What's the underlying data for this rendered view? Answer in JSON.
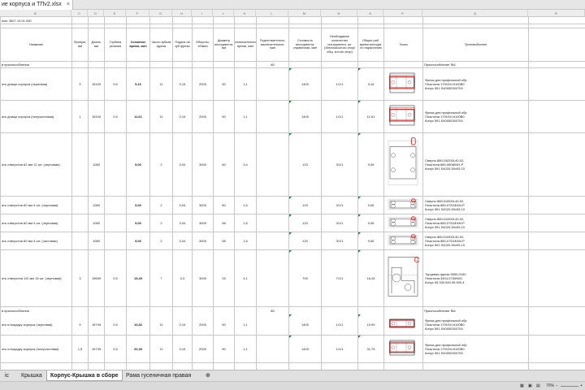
{
  "document": {
    "title": "ие корпуса и ТПv2.xlsx",
    "close_label": "×",
    "title_note": "ния: 3507.10.01.000"
  },
  "columns": [
    "B",
    "C",
    "D",
    "E",
    "F",
    "G",
    "H",
    "I",
    "J",
    "K",
    "L",
    "M",
    "N",
    "O",
    "P",
    "Q",
    "R",
    "S"
  ],
  "headers": {
    "name": "Название",
    "allowance": "Припуск, мм",
    "length": "Длина, мм",
    "depth": "Глубина резания",
    "main_time": "Основное время, мин",
    "teeth": "Число зубьев фрезы",
    "feed": "Подача на зуб фрезы",
    "rpm": "Обороты, об/мин",
    "diameter": "Диаметр инструмента, мм",
    "aux_time": "Вспомогательное время, мин",
    "prep_time": "Подготовительно-заключительное, мин",
    "cost": "Стоимость инструмента, справочная, мин",
    "tools_qty": "Необходимое количество инструмента, шт (Заточка/кол-во опор/общ. кол-во опор)",
    "total_time": "Общее раб. время инструм. по нарастанию",
    "sketch": "Эскиз",
    "fixture": "Противобоэнее"
  },
  "groups": {
    "group1": "в приспособлении",
    "group2": "в приспособлении",
    "prep": "80",
    "fixture_name": "Приспособление №1"
  },
  "rows": [
    {
      "name": "ать днище корпуса (черновая)",
      "allowance": "9",
      "length": "15100",
      "depth": "0,5",
      "main_time": "9,16",
      "teeth": "11",
      "feed": "0,15",
      "rpm": "2000",
      "diameter": "90",
      "aux_time": "1,1",
      "cost": "1400",
      "tools_qty": "1/1/1",
      "total_time": "9,16",
      "tool1": "Фреза для профильной обр",
      "tool2": "Пластина 179V40-N100B0",
      "tool3": "Конус 591.S40050300700",
      "sketch": "plan"
    },
    {
      "name": "ать днище корпуса (получистовая)",
      "allowance": "1",
      "length": "15100",
      "depth": "0,5",
      "main_time": "11,61",
      "teeth": "11",
      "feed": "0,15",
      "rpm": "2000",
      "diameter": "90",
      "aux_time": "1,1",
      "cost": "1400",
      "tools_qty": "1/1/1",
      "total_time": "11,61",
      "tool1": "Фреза для профильной обр",
      "tool2": "Пластина 179V40-N100B0",
      "tool3": "Конус 591.S40050300700",
      "sketch": "plan"
    },
    {
      "name": "ать отверстия 62 мм 12 шт. (черновая)",
      "allowance": "",
      "length": "1080",
      "depth": "",
      "main_time": "9,06",
      "teeth": "2",
      "feed": "0,04",
      "rpm": "3000",
      "diameter": "60",
      "aux_time": "3,4",
      "cost": "120",
      "tools_qty": "3/1/1",
      "total_time": "9,06",
      "tool1": "Сверло 880-D6200L40-02,",
      "tool2": "Пластина 880-080804H-P",
      "tool3": "Конус 591.S4020-50x05.10",
      "sketch": "holes"
    },
    {
      "name": "ать отверстия 60 мм 4 шт. (черновая)",
      "allowance": "",
      "length": "1080",
      "depth": "",
      "main_time": "9,06",
      "teeth": "2",
      "feed": "0,04",
      "rpm": "3000",
      "diameter": "60",
      "aux_time": "1,6",
      "cost": "120",
      "tools_qty": "3/1/1",
      "total_time": "9,06",
      "tool1": "Сверло 880-D4300L40-02,",
      "tool2": "Пластина 880-07D4E4M-P",
      "tool3": "Конус 591.S4020-50x05.10",
      "sketch": "holes"
    },
    {
      "name": "ать отверстия 60 мм 4 шт. (черновая)",
      "allowance": "",
      "length": "1080",
      "depth": "",
      "main_time": "9,06",
      "teeth": "2",
      "feed": "0,04",
      "rpm": "3000",
      "diameter": "58",
      "aux_time": "1,6",
      "cost": "120",
      "tools_qty": "3/1/1",
      "total_time": "9,06",
      "tool1": "Сверло 880-D4300L40-02,",
      "tool2": "Пластина 880-07D4E4M-P",
      "tool3": "Конус 591.S4020-50x05.10",
      "sketch": "holes"
    },
    {
      "name": "ать отверстия 60 мм 4 шт. (чистовая)",
      "allowance": "",
      "length": "1080",
      "depth": "",
      "main_time": "9,06",
      "teeth": "2",
      "feed": "0,04",
      "rpm": "3000",
      "diameter": "58",
      "aux_time": "1,6",
      "cost": "120",
      "tools_qty": "3/1/1",
      "total_time": "9,06",
      "tool1": "Сверло 880-D4300L40-02,",
      "tool2": "Пластина 880-07D4E4M-P",
      "tool3": "Конус 591.S4020-50x05.10",
      "sketch": "holes"
    },
    {
      "name": "ать отверстия 110 мм 16 шт. (черновая)",
      "allowance": "3",
      "length": "19659",
      "depth": "0,5",
      "main_time": "15,49",
      "teeth": "7",
      "feed": "0,3",
      "rpm": "3000",
      "diameter": "25",
      "aux_time": "4,1",
      "cost": "700",
      "tools_qty": "7/1/1",
      "total_time": "16,44",
      "tool1": "Торцевая фреза 5550-0150",
      "tool2": "Пластина 3404-0750N00-",
      "tool3": "Конус 05.330.540.05.500.4",
      "sketch": "plan2"
    },
    {
      "name": "ать площадку корпуса (черновая)",
      "allowance": "9",
      "length": "19749",
      "depth": "0,5",
      "main_time": "10,82",
      "teeth": "11",
      "feed": "0,15",
      "rpm": "2000",
      "diameter": "90",
      "aux_time": "1,1",
      "cost": "1400",
      "tools_qty": "1/1/1",
      "total_time": "10,99",
      "tool1": "Фреза для профильной обр",
      "tool2": "Пластина 179V40-N100B0",
      "tool3": "Конус 591.S40050300700",
      "sketch": "side"
    },
    {
      "name": "ать площадку корпуса (получистовая)",
      "allowance": "1,5",
      "length": "19749",
      "depth": "0,5",
      "main_time": "20,39",
      "teeth": "11",
      "feed": "0,15",
      "rpm": "2000",
      "diameter": "90",
      "aux_time": "1,1",
      "cost": "1400",
      "tools_qty": "1/1/1",
      "total_time": "31,75",
      "tool1": "Фреза для профильной обр",
      "tool2": "Пластина 179V40-N100B0",
      "tool3": "Конус 591.S40050300700",
      "sketch": "side"
    }
  ],
  "sheet_tabs": [
    "іс",
    "Крышка",
    "Корпус-Крышка в сборе",
    "Рама гусеничная правая"
  ],
  "active_tab": 2,
  "status": {
    "zoom": "70%",
    "zoom_minus": "−",
    "zoom_plus": "+"
  },
  "colors": {
    "sketch_highlight": "#e02020",
    "comment_marker": "#1f7a3a"
  }
}
